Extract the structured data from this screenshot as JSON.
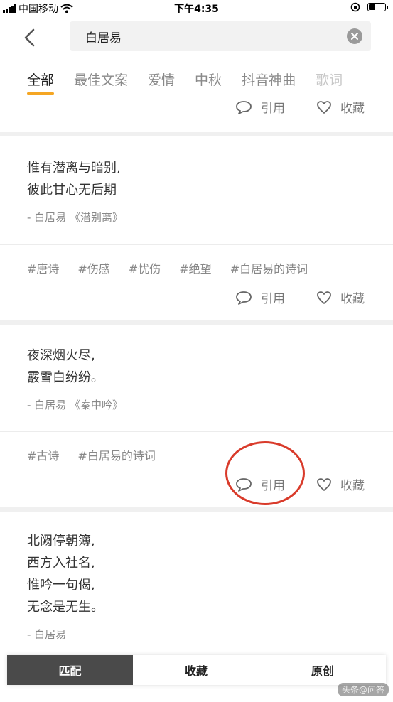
{
  "status_bar": {
    "carrier": "中国移动",
    "time": "下午4:35"
  },
  "search": {
    "value": "白居易"
  },
  "tabs": [
    {
      "label": "全部",
      "active": true
    },
    {
      "label": "最佳文案"
    },
    {
      "label": "爱情"
    },
    {
      "label": "中秋"
    },
    {
      "label": "抖音神曲"
    },
    {
      "label": "歌词"
    }
  ],
  "actions": {
    "quote_label": "引用",
    "favorite_label": "收藏"
  },
  "cards": [
    {
      "lines": [
        "惟有潜离与暗别,",
        "彼此甘心无后期"
      ],
      "source": "- 白居易 《潜别离》",
      "tags": [
        "#唐诗",
        "#伤感",
        "#忧伤",
        "#绝望",
        "#白居易的诗词"
      ]
    },
    {
      "lines": [
        "夜深烟火尽,",
        "霰雪白纷纷。"
      ],
      "source": "- 白居易 《秦中吟》",
      "tags": [
        "#古诗",
        "#白居易的诗词"
      ]
    },
    {
      "lines": [
        "北阙停朝簿,",
        "西方入社名,",
        "惟吟一句偈,",
        "无念是无生。"
      ],
      "source": "- 白居易"
    }
  ],
  "bottom_tabs": [
    {
      "label": "匹配",
      "active": true
    },
    {
      "label": "收藏"
    },
    {
      "label": "原创"
    }
  ],
  "watermark": "头条@问答",
  "colors": {
    "accent": "#f5a623",
    "annotation": "#d93b2b",
    "active_segment": "#4a4a4a"
  }
}
